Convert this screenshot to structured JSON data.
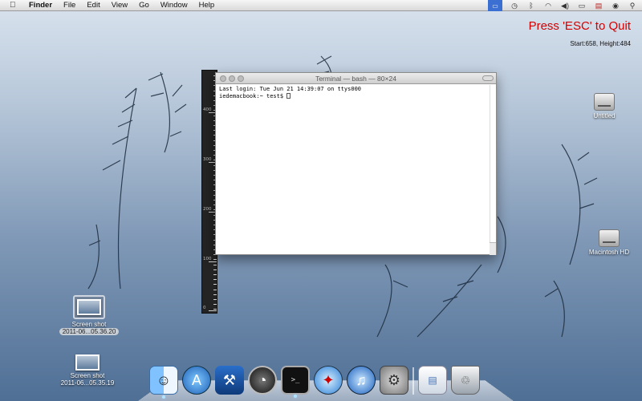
{
  "menubar": {
    "app": "Finder",
    "items": [
      "File",
      "Edit",
      "View",
      "Go",
      "Window",
      "Help"
    ],
    "status_icons": [
      "display-icon",
      "time-machine-icon",
      "bluetooth-icon",
      "wifi-icon",
      "volume-icon",
      "battery-icon",
      "flag-icon",
      "user-icon",
      "spotlight-icon"
    ]
  },
  "overlay": {
    "esc_message": "Press 'ESC' to Quit",
    "start_info": "Start:658, Height:484"
  },
  "terminal": {
    "title": "Terminal — bash — 80×24",
    "line1": "Last login: Tue Jun 21 14:39:07 on ttys000",
    "line2": "iedemacbook:~ test$"
  },
  "ruler": {
    "labels": [
      "400",
      "300",
      "200",
      "100",
      "0"
    ]
  },
  "desktop": {
    "icons": [
      {
        "label": "Untitled",
        "type": "drive"
      },
      {
        "label": "Macintosh HD",
        "type": "drive"
      },
      {
        "label": "Screen shot 2011-06...05.36.20",
        "type": "screenshot",
        "line1": "Screen shot",
        "line2": "2011-06...05.36.20",
        "selected": true
      },
      {
        "label": "Screen shot 2011-06...05.35.19",
        "type": "screenshot",
        "line1": "Screen shot",
        "line2": "2011-06...05.35.19",
        "selected": false
      }
    ]
  },
  "dock": {
    "apps": [
      "finder-icon",
      "app-store-icon",
      "xcode-icon",
      "dashboard-icon",
      "terminal-icon",
      "safari-icon",
      "itunes-icon",
      "system-preferences-icon",
      "documents-stack-icon",
      "trash-icon"
    ]
  }
}
